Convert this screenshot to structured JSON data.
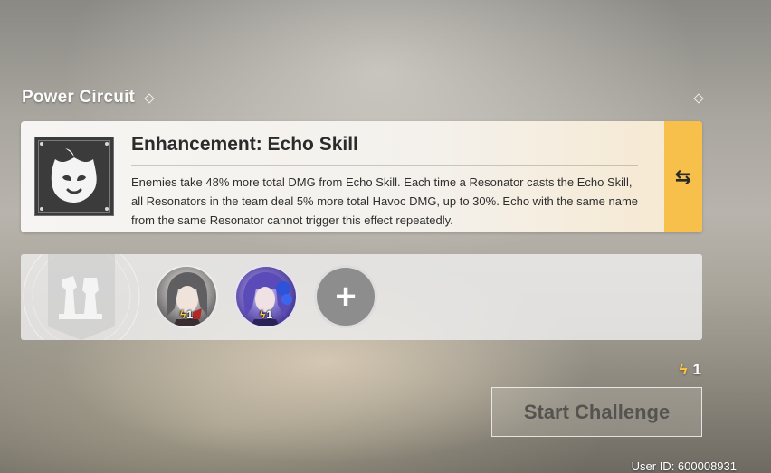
{
  "header": {
    "title": "Power Circuit"
  },
  "effect": {
    "title": "Enhancement: Echo Skill",
    "description": "Enemies take 48% more total DMG from Echo Skill. Each time a Resonator casts the Echo Skill, all Resonators in the team deal 5% more total Havoc DMG, up to 30%. Echo with the same name from the same Resonator cannot trigger this effect repeatedly.",
    "icon": "ghost-mask-icon",
    "swap_icon": "swap-arrows-icon",
    "swap_symbol": "⇆"
  },
  "team": {
    "members": [
      {
        "cost": "1",
        "portrait": "grey-haired-resonator-portrait"
      },
      {
        "cost": "1",
        "portrait": "purple-haired-resonator-portrait"
      }
    ],
    "add_symbol": "+",
    "emblem_icon": "chess-pieces-emblem-icon"
  },
  "footer": {
    "total_cost": "1",
    "start_label": "Start Challenge",
    "user_id": "User ID: 600008931"
  },
  "colors": {
    "accent": "#f7c04a",
    "bolt": "#ffc640"
  }
}
